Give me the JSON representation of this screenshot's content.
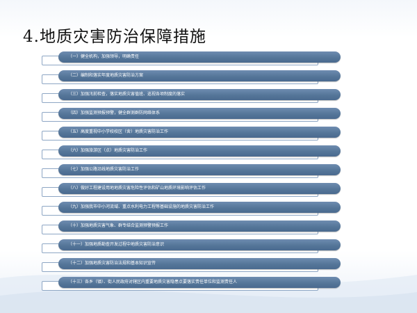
{
  "title": "4.地质灾害防治保障措施",
  "items": [
    {
      "label": "（一）健全机构，加强领导，明确责任"
    },
    {
      "label": "（二）编制和落实年度地质灾害防治方案"
    },
    {
      "label": "（三）加强汛前检查，落实地质灾害值班、巡视各项制度的落实"
    },
    {
      "label": "（四）加强监测预报预警，健全群测群防网络体系"
    },
    {
      "label": "（五）高度重视中小学校校区（舍）地质灾害防治工作"
    },
    {
      "label": "（六）加强旅游区（点）地质灾害防治工作"
    },
    {
      "label": "（七）加强公路沿线地质灾害防治工作"
    },
    {
      "label": "（八）做好工程建设用地地质灾害危险性评估和矿山地质环境影响评估工作"
    },
    {
      "label": "（九）加强我市中小河流域、重点水利电力工程等基础设施的地质灾害防治工作"
    },
    {
      "label": "（十）加强地质灾害气象、群专结合监测预警预报工作"
    },
    {
      "label": "（十一）加强地质勘查开发过程中地质灾害防治意识"
    },
    {
      "label": "（十二）加强地质灾害防治法规和基本知识宣传"
    },
    {
      "label": "（十三）各乡（镇）、街人民政府对辖区内重要地质灾害隐患点要落实责任单位和监测责任人"
    }
  ],
  "colors": {
    "pill": "#557699",
    "outline": "#8da6c4",
    "title": "#111111"
  }
}
